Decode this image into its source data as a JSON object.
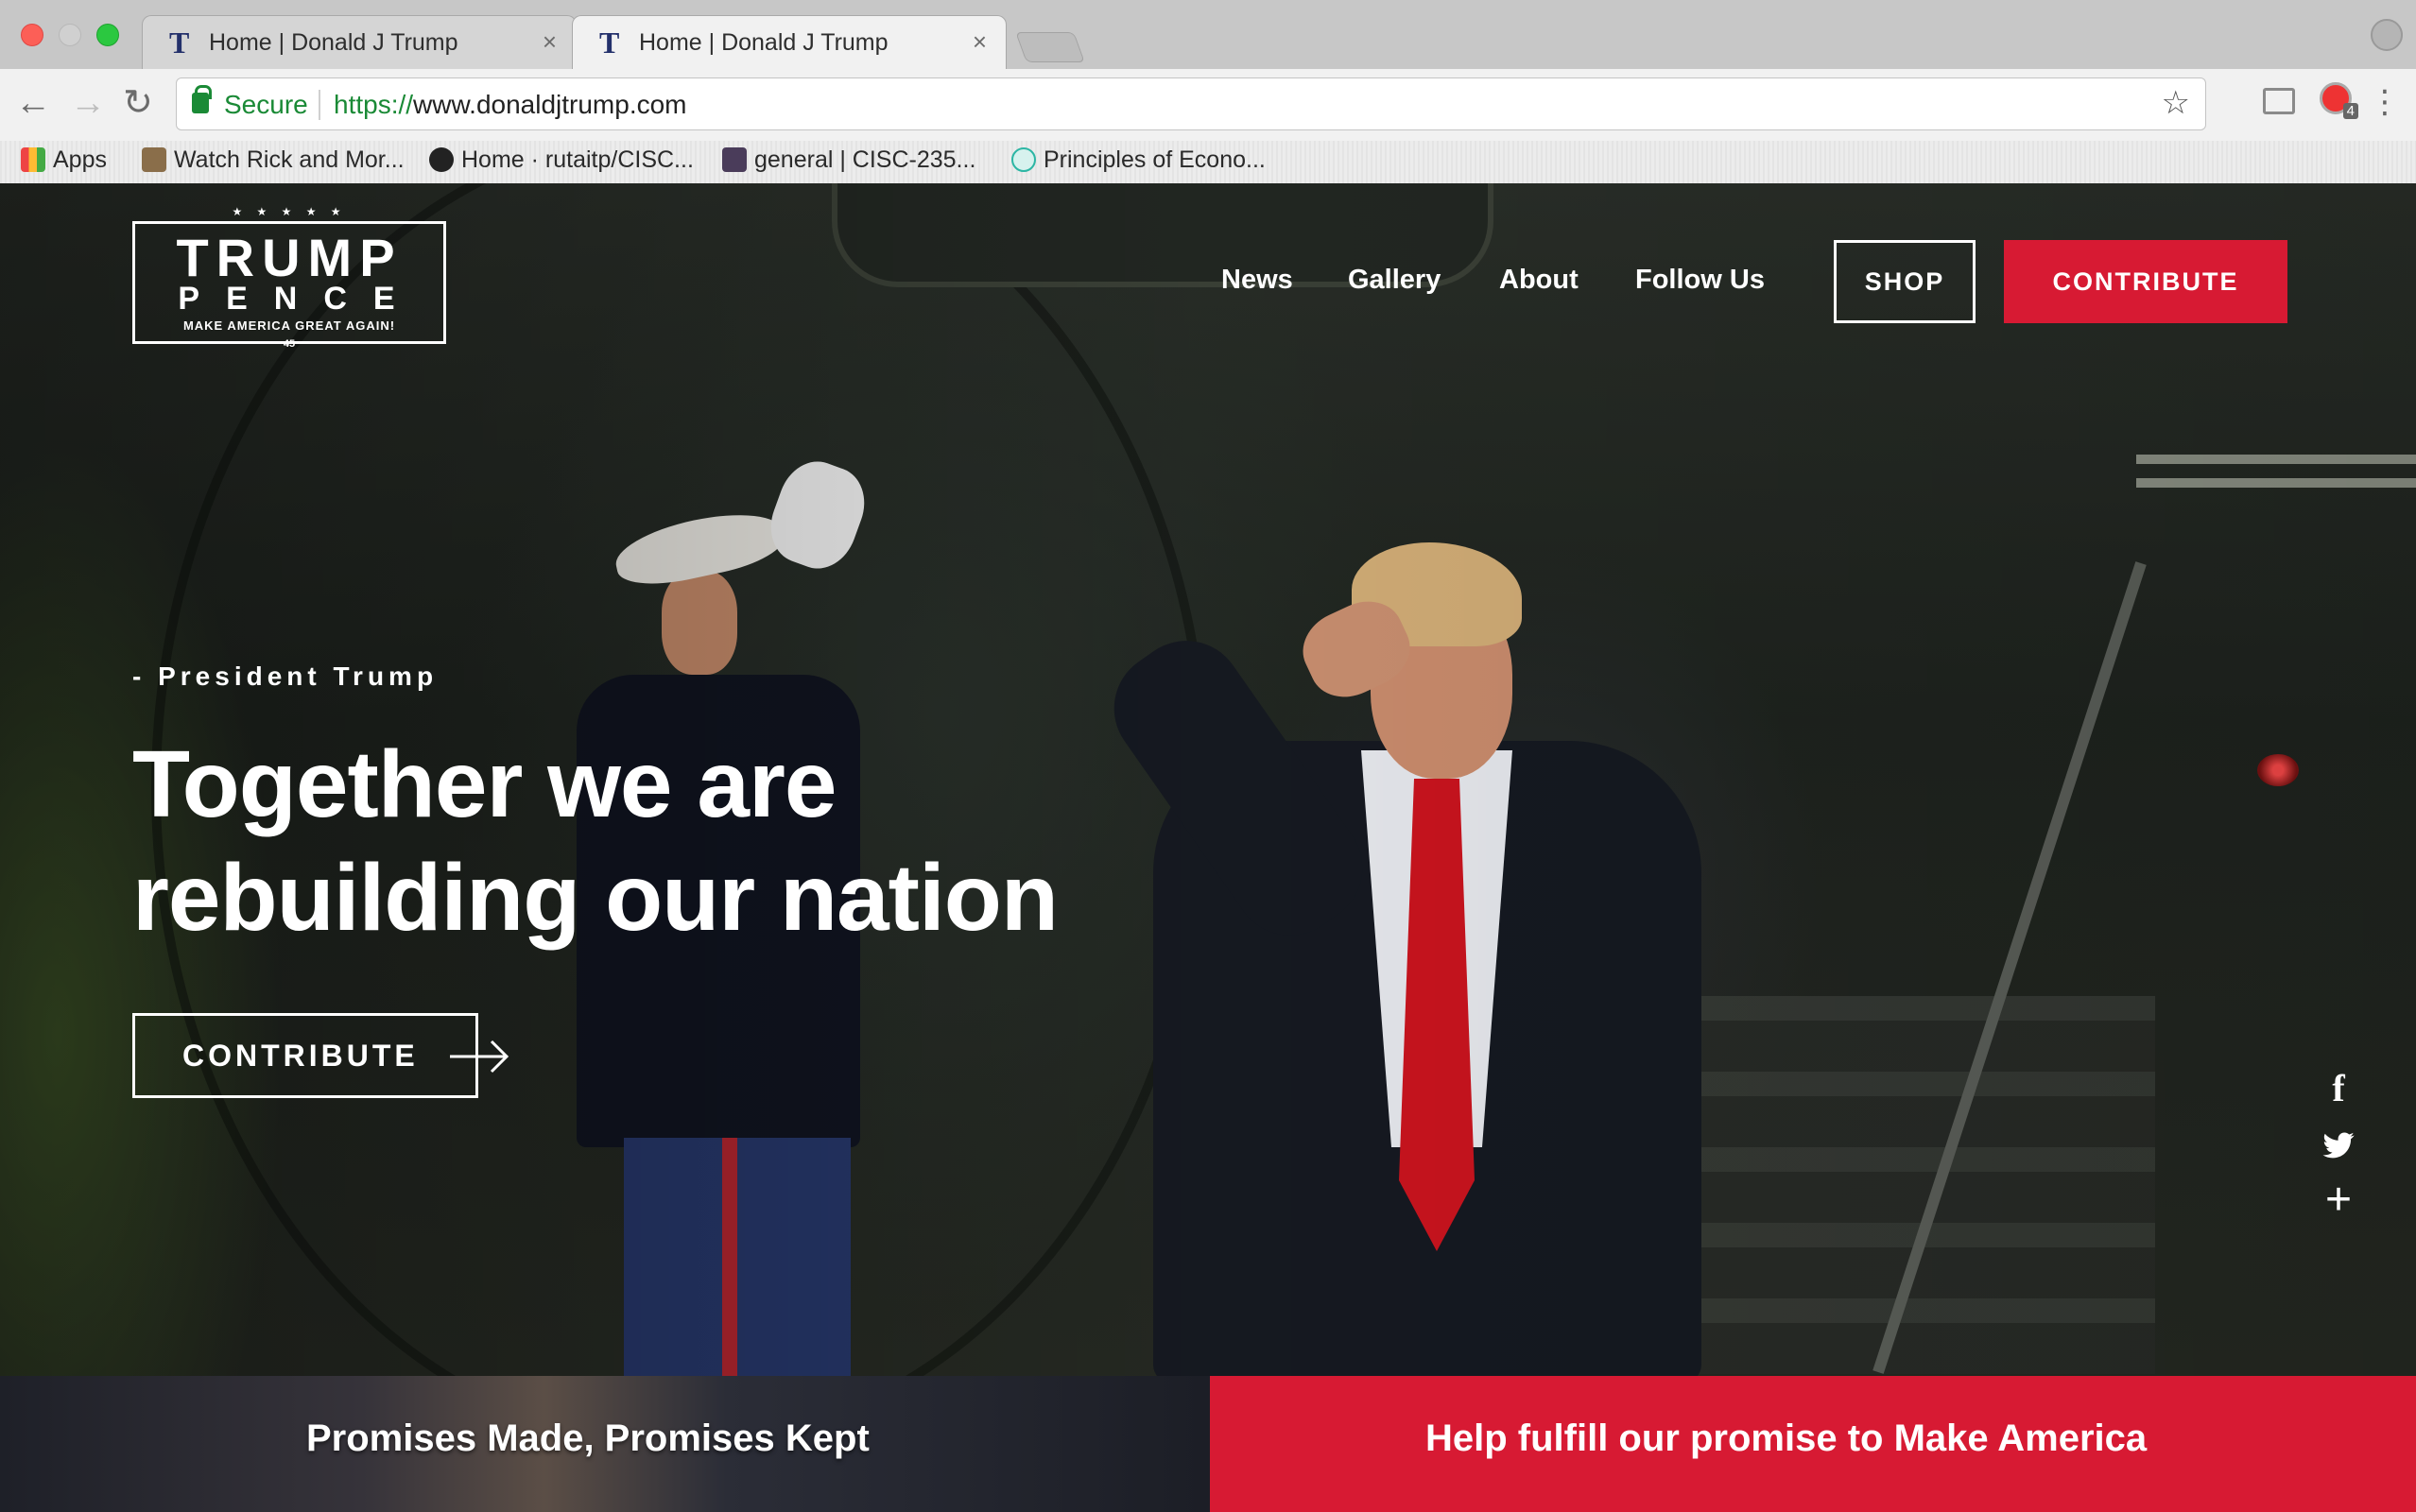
{
  "browser": {
    "tabs": [
      {
        "title": "Home | Donald J Trump",
        "favicon": "T",
        "active": false
      },
      {
        "title": "Home | Donald J Trump",
        "favicon": "T",
        "active": true
      }
    ],
    "omnibox": {
      "secure_label": "Secure",
      "scheme": "https://",
      "host": "www.donaldjtrump.com"
    },
    "extension_badge_count": "4",
    "bookmarks": [
      {
        "label": "Apps",
        "icon": "apps-grid-icon"
      },
      {
        "label": "Watch Rick and Mor...",
        "icon": "tv-icon"
      },
      {
        "label": "Home · rutaitp/CISC...",
        "icon": "github-icon"
      },
      {
        "label": "general | CISC-235...",
        "icon": "slack-hash-icon"
      },
      {
        "label": "Principles of Econo...",
        "icon": "econ-icon"
      }
    ]
  },
  "site": {
    "logo": {
      "stars": "★ ★ ★ ★ ★",
      "line1": "TRUMP",
      "line2": "PENCE",
      "tagline": "MAKE AMERICA GREAT AGAIN!",
      "number": "45"
    },
    "nav": [
      "News",
      "Gallery",
      "About",
      "Follow Us"
    ],
    "shop_label": "SHOP",
    "contribute_label": "CONTRIBUTE",
    "hero": {
      "kicker": "- President Trump",
      "headline_line1": "Together we are",
      "headline_line2": "rebuilding our nation",
      "cta_label": "CONTRIBUTE"
    },
    "social": [
      "facebook-icon",
      "twitter-icon",
      "plus-icon"
    ],
    "promises_heading": "Promises Made, Promises Kept",
    "help_heading": "Help fulfill our promise to Make America"
  },
  "colors": {
    "accent_red": "#d71a33",
    "secure_green": "#1a8a36"
  }
}
